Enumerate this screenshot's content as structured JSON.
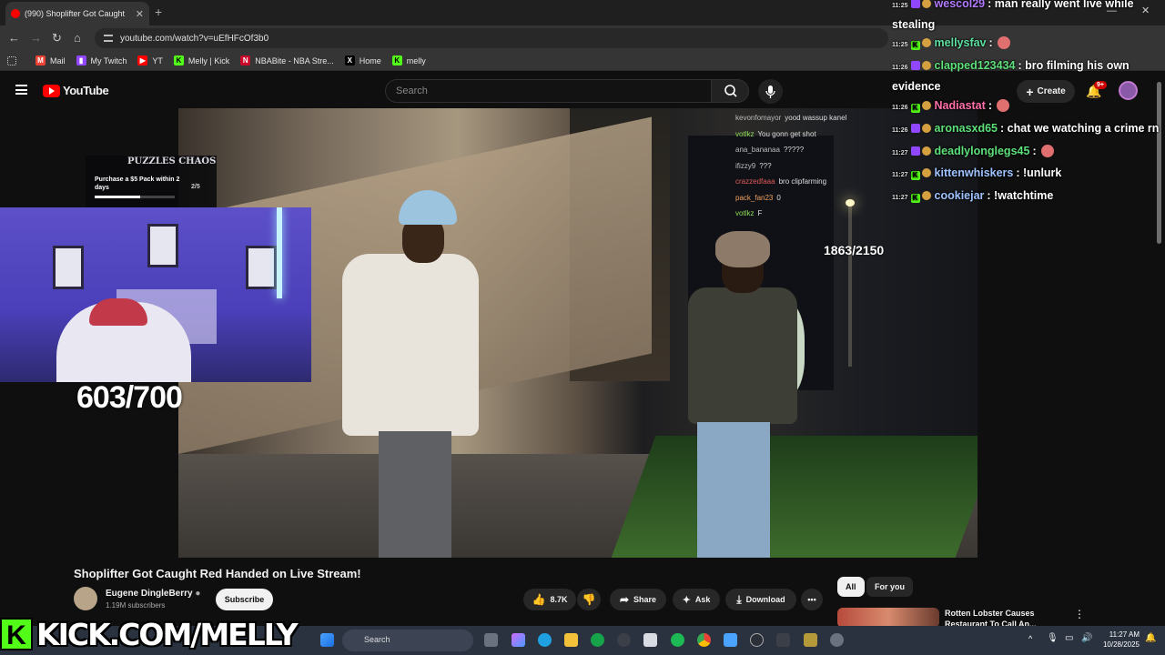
{
  "browser": {
    "tab_title": "(990) Shoplifter Got Caught",
    "url": "youtube.com/watch?v=uEfHFcOf3b0",
    "bookmarks": [
      {
        "label": "Mail",
        "color": "#ea4335",
        "glyph": "M"
      },
      {
        "label": "My Twitch",
        "color": "#9146ff",
        "glyph": "▮"
      },
      {
        "label": "YT",
        "color": "#ff0000",
        "glyph": "▶"
      },
      {
        "label": "Melly | Kick",
        "color": "#53fc18",
        "glyph": "K"
      },
      {
        "label": "NBABite - NBA Stre...",
        "color": "#c9082a",
        "glyph": "N"
      },
      {
        "label": "Home",
        "color": "#000000",
        "glyph": "X"
      },
      {
        "label": "melly",
        "color": "#53fc18",
        "glyph": "K"
      }
    ]
  },
  "youtube": {
    "logo_text": "YouTube",
    "search_placeholder": "Search",
    "create_label": "Create",
    "notif_badge": "9+"
  },
  "overlays": {
    "puzzle_logo": "PUZZLES CHAOS",
    "puzzle_text": "Purchase a $5 Pack within 2 days",
    "puzzle_progress": "2/5",
    "puzzle_fraction": 0.57,
    "left_counter": "603/700",
    "video_counter": "1863/2150",
    "kick_letter": "K",
    "kick_text": "KICK.COM/MELLY"
  },
  "video_chat": [
    {
      "user": "kevonfomayor",
      "text": "yood wassup kanel",
      "cls": "u"
    },
    {
      "user": "votlkz",
      "text": "You gonn get shot",
      "cls": "g"
    },
    {
      "user": "ana_bananaa",
      "text": "?????",
      "cls": "u"
    },
    {
      "user": "ifizzy9",
      "text": "???",
      "cls": "u"
    },
    {
      "user": "crazzedfaaa",
      "text": "bro clipfarming",
      "cls": "r"
    },
    {
      "user": "pack_fan23",
      "text": "0",
      "cls": "o"
    },
    {
      "user": "votlkz",
      "text": "F",
      "cls": "g"
    }
  ],
  "stream_chat": [
    {
      "time": "11:25",
      "icon": "t",
      "user": "wescol29",
      "color": "#b27bff",
      "text": ": man really went live while",
      "cont": "stealing"
    },
    {
      "time": "11:25",
      "icon": "k",
      "user": "mellysfav",
      "color": "#5ee0a0",
      "text": ":",
      "cont": ""
    },
    {
      "time": "11:26",
      "icon": "t",
      "user": "clapped123434",
      "color": "#5ee07a",
      "text": ": bro filming his own",
      "cont": "evidence"
    },
    {
      "time": "11:26",
      "icon": "k",
      "user": "Nadiastat",
      "color": "#ff6fa8",
      "text": ":",
      "cont": ""
    },
    {
      "time": "11:26",
      "icon": "t",
      "user": "aronasxd65",
      "color": "#5ee07a",
      "text": ": chat we watching a crime rn",
      "cont": ""
    },
    {
      "time": "11:27",
      "icon": "t",
      "user": "deadlylonglegs45",
      "color": "#5ee07a",
      "text": ":",
      "cont": ""
    },
    {
      "time": "11:27",
      "icon": "k",
      "user": "kittenwhiskers",
      "color": "#9ec3ff",
      "text": ": !unlurk",
      "cont": ""
    },
    {
      "time": "11:27",
      "icon": "k",
      "user": "cookiejar",
      "color": "#9ec3ff",
      "text": ": !watchtime",
      "cont": ""
    }
  ],
  "video_info": {
    "title": "Shoplifter Got Caught Red Handed on Live Stream!",
    "channel": "Eugene DingleBerry",
    "subscribers": "1.19M subscribers",
    "subscribe_label": "Subscribe",
    "likes": "8.7K",
    "share": "Share",
    "ask": "Ask",
    "download": "Download"
  },
  "sidebar": {
    "chips": [
      "All",
      "For you"
    ],
    "rec_title": "Rotten Lobster Causes Restaurant To Call An..."
  },
  "taskbar": {
    "search": "Search",
    "time": "11:27 AM",
    "date": "10/28/2025"
  }
}
